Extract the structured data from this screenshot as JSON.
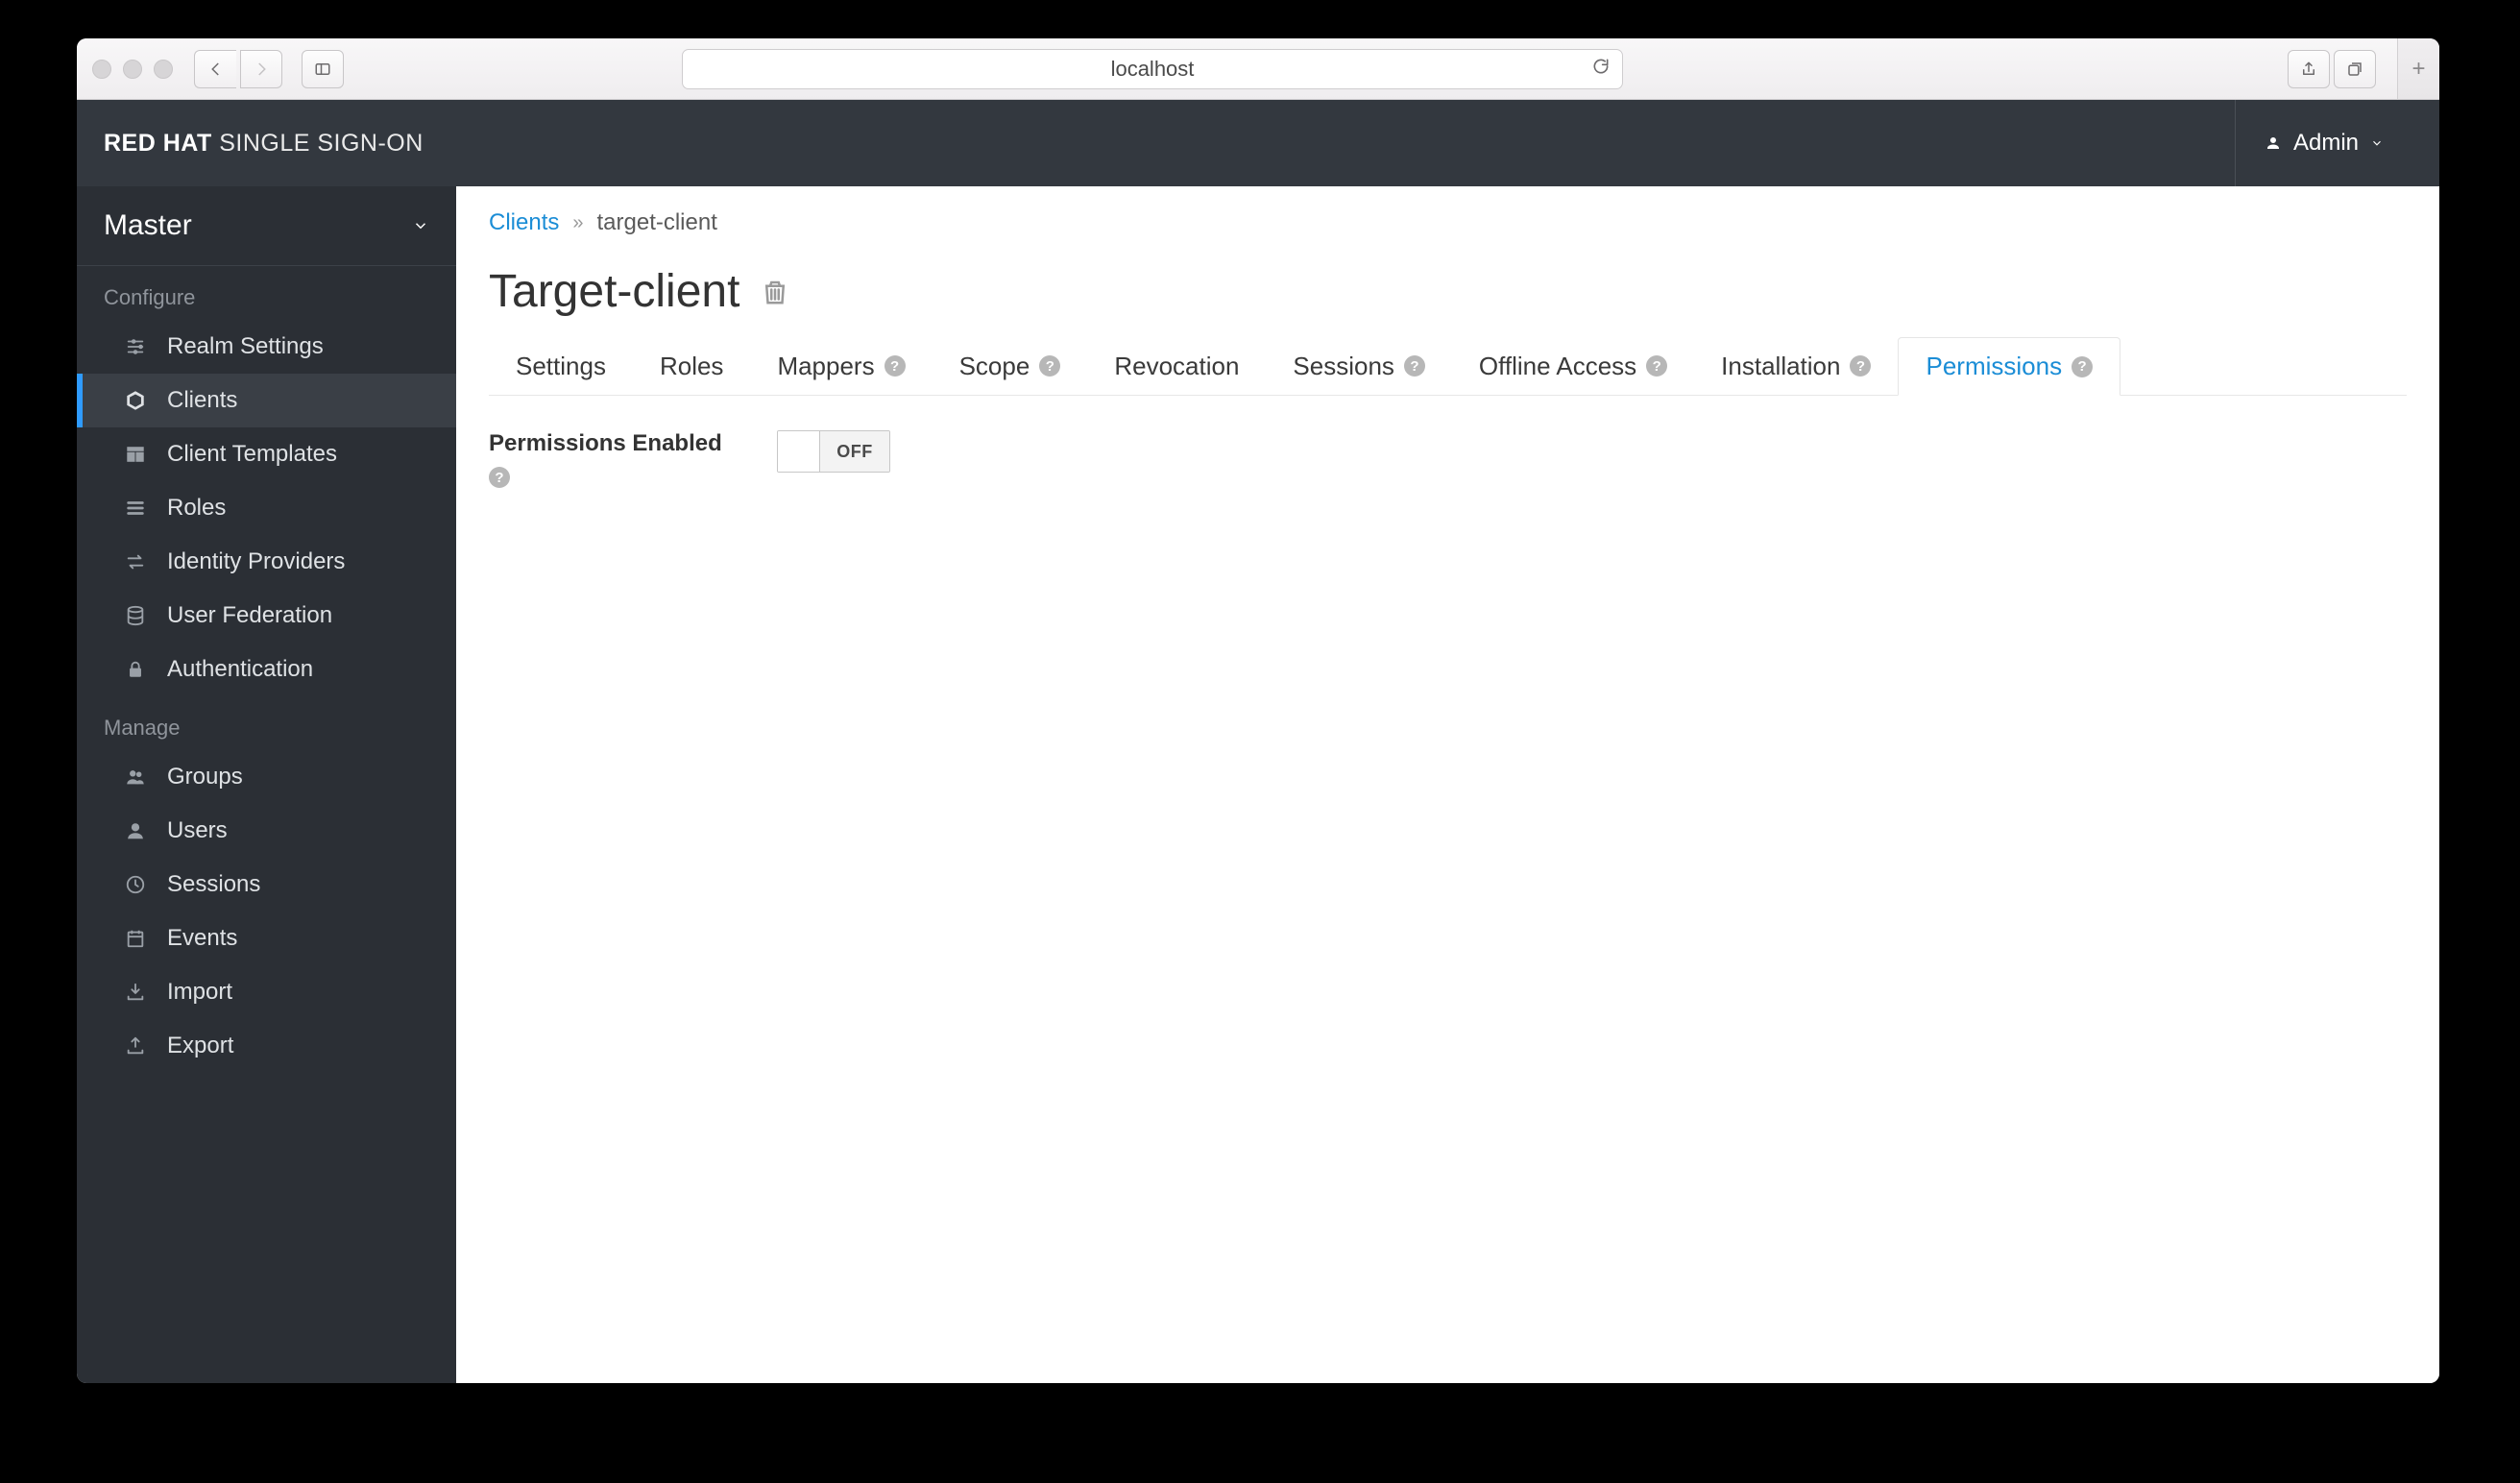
{
  "browser": {
    "address": "localhost"
  },
  "header": {
    "brand_bold": "RED HAT",
    "brand_light": "SINGLE SIGN-ON",
    "user": "Admin"
  },
  "sidebar": {
    "realm": "Master",
    "configure_label": "Configure",
    "manage_label": "Manage",
    "configure": [
      {
        "label": "Realm Settings"
      },
      {
        "label": "Clients"
      },
      {
        "label": "Client Templates"
      },
      {
        "label": "Roles"
      },
      {
        "label": "Identity Providers"
      },
      {
        "label": "User Federation"
      },
      {
        "label": "Authentication"
      }
    ],
    "manage": [
      {
        "label": "Groups"
      },
      {
        "label": "Users"
      },
      {
        "label": "Sessions"
      },
      {
        "label": "Events"
      },
      {
        "label": "Import"
      },
      {
        "label": "Export"
      }
    ]
  },
  "breadcrumb": {
    "root": "Clients",
    "current": "target-client"
  },
  "page": {
    "title": "Target-client"
  },
  "tabs": [
    {
      "label": "Settings",
      "help": false
    },
    {
      "label": "Roles",
      "help": false
    },
    {
      "label": "Mappers",
      "help": true
    },
    {
      "label": "Scope",
      "help": true
    },
    {
      "label": "Revocation",
      "help": false
    },
    {
      "label": "Sessions",
      "help": true
    },
    {
      "label": "Offline Access",
      "help": true
    },
    {
      "label": "Installation",
      "help": true
    },
    {
      "label": "Permissions",
      "help": true
    }
  ],
  "form": {
    "permissions_label": "Permissions Enabled",
    "toggle_state": "OFF"
  }
}
